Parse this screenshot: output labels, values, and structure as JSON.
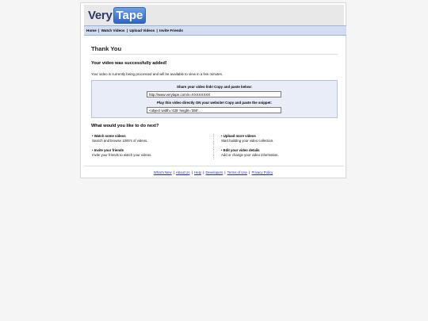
{
  "header": {
    "logo_very": "Very",
    "logo_tape": "Tape"
  },
  "nav": {
    "items": [
      "Home",
      "Watch Videos",
      "Upload Videos",
      "Invite Friends"
    ],
    "separator": "|"
  },
  "main": {
    "title": "Thank You",
    "success": "Your video was successfully added!",
    "processing": "Your video is currently being processed and will be available to view in a few minutes.",
    "share": {
      "link_label": "Share your video link! Copy and paste below:",
      "link_value": "http://www.verytape.com/v=XXXXXXXX",
      "embed_label": "Play this video directly ON your website! Copy and paste the snippet:",
      "embed_value": "<object width='425' height='350'..."
    },
    "next_title": "What would you like to do next?",
    "options": [
      {
        "title": "Watch some videos",
        "desc": "Search and browse 1000's of videos."
      },
      {
        "title": "Upload more videos",
        "desc": "Start building your video collection."
      },
      {
        "title": "Invite your friends",
        "desc": "Invite your friends to watch your videos."
      },
      {
        "title": "Edit your video details",
        "desc": "Add or change your video information."
      }
    ],
    "bullet": "•"
  },
  "footer": {
    "links": [
      "What's New",
      "About Us",
      "Help",
      "Developers",
      "Terms of Use",
      "Privacy Policy"
    ],
    "separator": "|"
  }
}
